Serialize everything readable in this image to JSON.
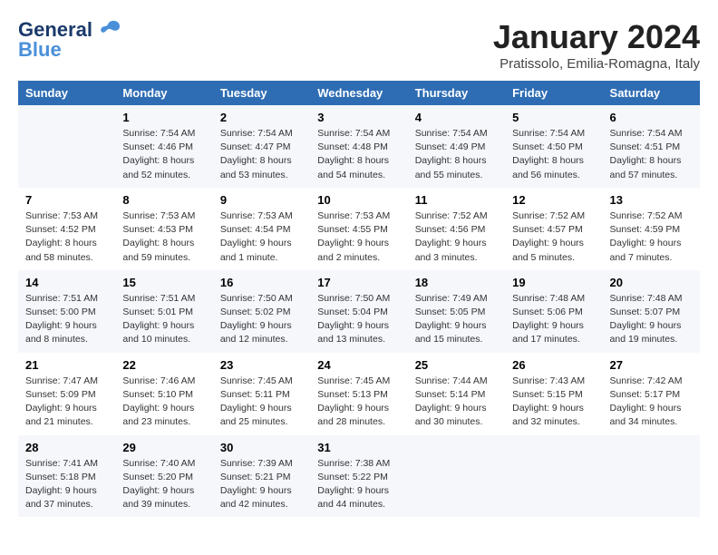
{
  "header": {
    "logo_line1": "General",
    "logo_line2": "Blue",
    "title": "January 2024",
    "subtitle": "Pratissolo, Emilia-Romagna, Italy"
  },
  "weekdays": [
    "Sunday",
    "Monday",
    "Tuesday",
    "Wednesday",
    "Thursday",
    "Friday",
    "Saturday"
  ],
  "weeks": [
    [
      {
        "day": "",
        "sunrise": "",
        "sunset": "",
        "daylight": ""
      },
      {
        "day": "1",
        "sunrise": "Sunrise: 7:54 AM",
        "sunset": "Sunset: 4:46 PM",
        "daylight": "Daylight: 8 hours and 52 minutes."
      },
      {
        "day": "2",
        "sunrise": "Sunrise: 7:54 AM",
        "sunset": "Sunset: 4:47 PM",
        "daylight": "Daylight: 8 hours and 53 minutes."
      },
      {
        "day": "3",
        "sunrise": "Sunrise: 7:54 AM",
        "sunset": "Sunset: 4:48 PM",
        "daylight": "Daylight: 8 hours and 54 minutes."
      },
      {
        "day": "4",
        "sunrise": "Sunrise: 7:54 AM",
        "sunset": "Sunset: 4:49 PM",
        "daylight": "Daylight: 8 hours and 55 minutes."
      },
      {
        "day": "5",
        "sunrise": "Sunrise: 7:54 AM",
        "sunset": "Sunset: 4:50 PM",
        "daylight": "Daylight: 8 hours and 56 minutes."
      },
      {
        "day": "6",
        "sunrise": "Sunrise: 7:54 AM",
        "sunset": "Sunset: 4:51 PM",
        "daylight": "Daylight: 8 hours and 57 minutes."
      }
    ],
    [
      {
        "day": "7",
        "sunrise": "Sunrise: 7:53 AM",
        "sunset": "Sunset: 4:52 PM",
        "daylight": "Daylight: 8 hours and 58 minutes."
      },
      {
        "day": "8",
        "sunrise": "Sunrise: 7:53 AM",
        "sunset": "Sunset: 4:53 PM",
        "daylight": "Daylight: 8 hours and 59 minutes."
      },
      {
        "day": "9",
        "sunrise": "Sunrise: 7:53 AM",
        "sunset": "Sunset: 4:54 PM",
        "daylight": "Daylight: 9 hours and 1 minute."
      },
      {
        "day": "10",
        "sunrise": "Sunrise: 7:53 AM",
        "sunset": "Sunset: 4:55 PM",
        "daylight": "Daylight: 9 hours and 2 minutes."
      },
      {
        "day": "11",
        "sunrise": "Sunrise: 7:52 AM",
        "sunset": "Sunset: 4:56 PM",
        "daylight": "Daylight: 9 hours and 3 minutes."
      },
      {
        "day": "12",
        "sunrise": "Sunrise: 7:52 AM",
        "sunset": "Sunset: 4:57 PM",
        "daylight": "Daylight: 9 hours and 5 minutes."
      },
      {
        "day": "13",
        "sunrise": "Sunrise: 7:52 AM",
        "sunset": "Sunset: 4:59 PM",
        "daylight": "Daylight: 9 hours and 7 minutes."
      }
    ],
    [
      {
        "day": "14",
        "sunrise": "Sunrise: 7:51 AM",
        "sunset": "Sunset: 5:00 PM",
        "daylight": "Daylight: 9 hours and 8 minutes."
      },
      {
        "day": "15",
        "sunrise": "Sunrise: 7:51 AM",
        "sunset": "Sunset: 5:01 PM",
        "daylight": "Daylight: 9 hours and 10 minutes."
      },
      {
        "day": "16",
        "sunrise": "Sunrise: 7:50 AM",
        "sunset": "Sunset: 5:02 PM",
        "daylight": "Daylight: 9 hours and 12 minutes."
      },
      {
        "day": "17",
        "sunrise": "Sunrise: 7:50 AM",
        "sunset": "Sunset: 5:04 PM",
        "daylight": "Daylight: 9 hours and 13 minutes."
      },
      {
        "day": "18",
        "sunrise": "Sunrise: 7:49 AM",
        "sunset": "Sunset: 5:05 PM",
        "daylight": "Daylight: 9 hours and 15 minutes."
      },
      {
        "day": "19",
        "sunrise": "Sunrise: 7:48 AM",
        "sunset": "Sunset: 5:06 PM",
        "daylight": "Daylight: 9 hours and 17 minutes."
      },
      {
        "day": "20",
        "sunrise": "Sunrise: 7:48 AM",
        "sunset": "Sunset: 5:07 PM",
        "daylight": "Daylight: 9 hours and 19 minutes."
      }
    ],
    [
      {
        "day": "21",
        "sunrise": "Sunrise: 7:47 AM",
        "sunset": "Sunset: 5:09 PM",
        "daylight": "Daylight: 9 hours and 21 minutes."
      },
      {
        "day": "22",
        "sunrise": "Sunrise: 7:46 AM",
        "sunset": "Sunset: 5:10 PM",
        "daylight": "Daylight: 9 hours and 23 minutes."
      },
      {
        "day": "23",
        "sunrise": "Sunrise: 7:45 AM",
        "sunset": "Sunset: 5:11 PM",
        "daylight": "Daylight: 9 hours and 25 minutes."
      },
      {
        "day": "24",
        "sunrise": "Sunrise: 7:45 AM",
        "sunset": "Sunset: 5:13 PM",
        "daylight": "Daylight: 9 hours and 28 minutes."
      },
      {
        "day": "25",
        "sunrise": "Sunrise: 7:44 AM",
        "sunset": "Sunset: 5:14 PM",
        "daylight": "Daylight: 9 hours and 30 minutes."
      },
      {
        "day": "26",
        "sunrise": "Sunrise: 7:43 AM",
        "sunset": "Sunset: 5:15 PM",
        "daylight": "Daylight: 9 hours and 32 minutes."
      },
      {
        "day": "27",
        "sunrise": "Sunrise: 7:42 AM",
        "sunset": "Sunset: 5:17 PM",
        "daylight": "Daylight: 9 hours and 34 minutes."
      }
    ],
    [
      {
        "day": "28",
        "sunrise": "Sunrise: 7:41 AM",
        "sunset": "Sunset: 5:18 PM",
        "daylight": "Daylight: 9 hours and 37 minutes."
      },
      {
        "day": "29",
        "sunrise": "Sunrise: 7:40 AM",
        "sunset": "Sunset: 5:20 PM",
        "daylight": "Daylight: 9 hours and 39 minutes."
      },
      {
        "day": "30",
        "sunrise": "Sunrise: 7:39 AM",
        "sunset": "Sunset: 5:21 PM",
        "daylight": "Daylight: 9 hours and 42 minutes."
      },
      {
        "day": "31",
        "sunrise": "Sunrise: 7:38 AM",
        "sunset": "Sunset: 5:22 PM",
        "daylight": "Daylight: 9 hours and 44 minutes."
      },
      {
        "day": "",
        "sunrise": "",
        "sunset": "",
        "daylight": ""
      },
      {
        "day": "",
        "sunrise": "",
        "sunset": "",
        "daylight": ""
      },
      {
        "day": "",
        "sunrise": "",
        "sunset": "",
        "daylight": ""
      }
    ]
  ]
}
